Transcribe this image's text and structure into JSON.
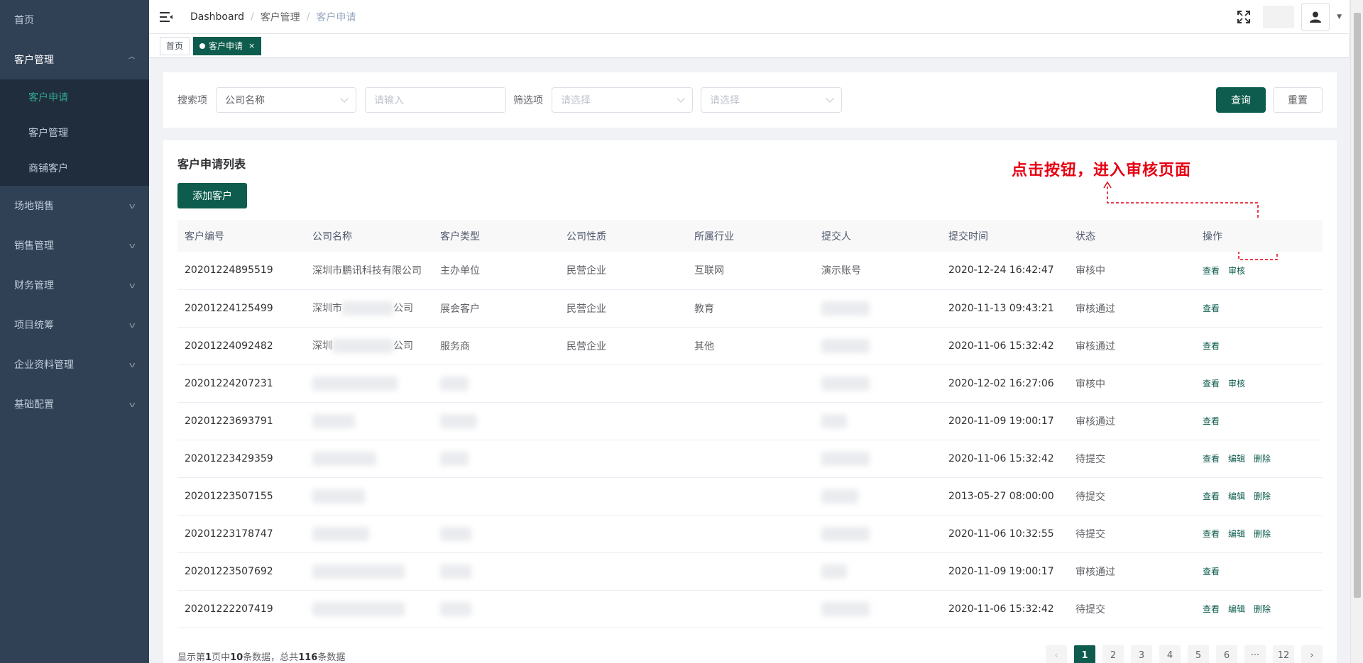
{
  "sidebar": {
    "items": [
      {
        "label": "首页"
      },
      {
        "label": "客户管理",
        "children": [
          "客户申请",
          "客户管理",
          "商铺客户"
        ]
      },
      {
        "label": "场地销售"
      },
      {
        "label": "销售管理"
      },
      {
        "label": "财务管理"
      },
      {
        "label": "项目统筹"
      },
      {
        "label": "企业资料管理"
      },
      {
        "label": "基础配置"
      }
    ]
  },
  "navbar": {
    "breadcrumb": [
      "Dashboard",
      "客户管理",
      "客户申请"
    ]
  },
  "tags": [
    {
      "label": "首页"
    },
    {
      "label": "客户申请",
      "close": "×"
    }
  ],
  "search": {
    "search_label": "搜索项",
    "search_field_value": "公司名称",
    "input_placeholder": "请输入",
    "filter_label": "筛选项",
    "filter1_placeholder": "请选择",
    "filter2_placeholder": "请选择",
    "query_btn": "查询",
    "reset_btn": "重置"
  },
  "list": {
    "title": "客户申请列表",
    "add_btn": "添加客户",
    "annotation": "点击按钮，进入审核页面",
    "columns": [
      "客户编号",
      "公司名称",
      "客户类型",
      "公司性质",
      "所属行业",
      "提交人",
      "提交时间",
      "状态",
      "操作"
    ],
    "rows": [
      {
        "code": "20201224895519",
        "company": "深圳市鹏讯科技有限公司",
        "type": "主办单位",
        "nature": "民营企业",
        "industry": "互联网",
        "submitter": "演示账号",
        "time": "2020-12-24 16:42:47",
        "status": "审核中",
        "ops": [
          "查看",
          "审核"
        ]
      },
      {
        "code": "20201224125499",
        "company_prefix": "深圳市",
        "company_suffix": "公司",
        "type": "展会客户",
        "nature": "民营企业",
        "industry": "教育",
        "time": "2020-11-13 09:43:21",
        "status": "审核通过",
        "ops": [
          "查看"
        ]
      },
      {
        "code": "20201224092482",
        "company_prefix": "深圳",
        "company_suffix": "公司",
        "type": "服务商",
        "nature": "民营企业",
        "industry": "其他",
        "time": "2020-11-06 15:32:42",
        "status": "审核通过",
        "ops": [
          "查看"
        ]
      },
      {
        "code": "20201224207231",
        "time": "2020-12-02 16:27:06",
        "status": "审核中",
        "ops": [
          "查看",
          "审核"
        ]
      },
      {
        "code": "20201223693791",
        "time": "2020-11-09 19:00:17",
        "status": "审核通过",
        "ops": [
          "查看"
        ]
      },
      {
        "code": "20201223429359",
        "time": "2020-11-06 15:32:42",
        "status": "待提交",
        "ops": [
          "查看",
          "编辑",
          "删除"
        ]
      },
      {
        "code": "20201223507155",
        "time": "2013-05-27 08:00:00",
        "status": "待提交",
        "ops": [
          "查看",
          "编辑",
          "删除"
        ]
      },
      {
        "code": "20201223178747",
        "time": "2020-11-06 10:32:55",
        "status": "待提交",
        "ops": [
          "查看",
          "编辑",
          "删除"
        ]
      },
      {
        "code": "20201223507692",
        "time": "2020-11-09 19:00:17",
        "status": "审核通过",
        "ops": [
          "查看"
        ]
      },
      {
        "code": "20201222207419",
        "time": "2020-11-06 15:32:42",
        "status": "待提交",
        "ops": [
          "查看",
          "编辑",
          "删除"
        ]
      }
    ]
  },
  "footer": {
    "prefix": "显示第",
    "page": "1",
    "mid1": "页中",
    "count": "10",
    "mid2": "条数据，总共",
    "total": "116",
    "suffix": "条数据"
  },
  "pagination": {
    "prev": "‹",
    "pages": [
      "1",
      "2",
      "3",
      "4",
      "5",
      "6",
      "···",
      "12"
    ],
    "next": "›",
    "current": "1"
  },
  "colors": {
    "primary": "#0d5c4d",
    "sidebar_bg": "#304156",
    "active_menu": "#31a88c",
    "annotation": "#e60012"
  }
}
